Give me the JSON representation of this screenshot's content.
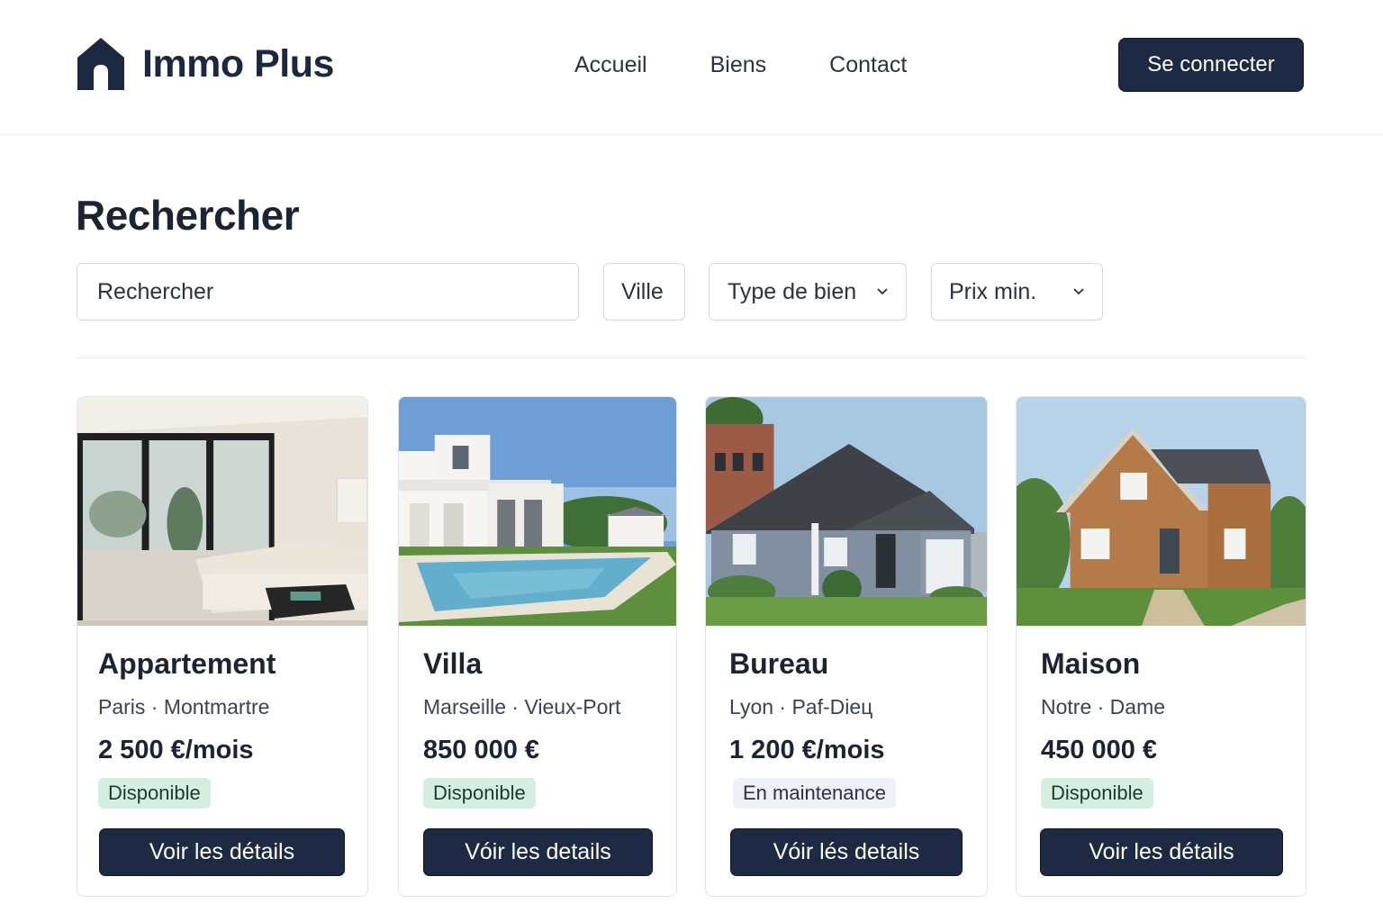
{
  "header": {
    "logo_text": "Immo Plus",
    "logo_icon": "house-icon",
    "nav": [
      "Accueil",
      "Biens",
      "Contact"
    ],
    "login_label": "Se connecter"
  },
  "search": {
    "title": "Rechercher",
    "query_placeholder": "Rechercher",
    "ville_label": "Ville",
    "type_label": "Type de bien",
    "prix_label": "Prix min."
  },
  "listings": [
    {
      "title": "Appartement",
      "location": "Paris · Montmartre",
      "price": "2 500 €/mois",
      "status": "Disponible",
      "cta": "Voir les détails"
    },
    {
      "title": "Villa",
      "location": "Marseille · Vieux-Port",
      "price": "850 000 €",
      "status": "Disponible",
      "cta": "Vóir les details"
    },
    {
      "title": "Bureau",
      "location": "Lyon · Paf-Dieц",
      "price": "1 200 €/mois",
      "status": "En maintenance",
      "cta": "Vóir lés details"
    },
    {
      "title": "Maison",
      "location": "Notre · Dame",
      "price": "450 000 €",
      "status": "Disponible",
      "cta": "Voir les détails"
    }
  ],
  "colors": {
    "primary": "#1e2a44",
    "badge_available": "#d4efe0",
    "badge_maintenance": "#edf1f6"
  }
}
